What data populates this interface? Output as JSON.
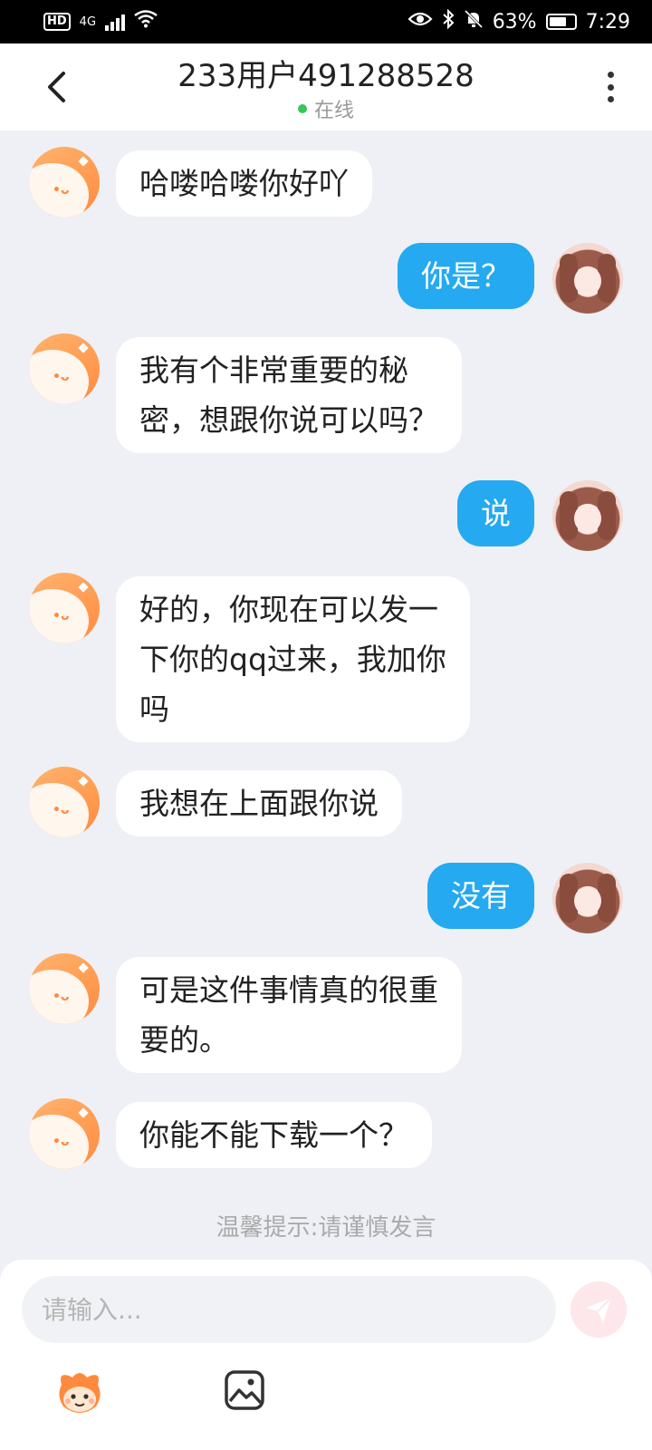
{
  "status_bar": {
    "hd": "HD",
    "network": "4G",
    "battery": "63%",
    "time": "7:29"
  },
  "header": {
    "title": "233用户491288528",
    "presence": "在线"
  },
  "messages": [
    {
      "from": "bot",
      "text": "哈喽哈喽你好吖"
    },
    {
      "from": "user",
      "text": "你是？"
    },
    {
      "from": "bot",
      "text": "我有个非常重要的秘\n密，想跟你说可以吗？"
    },
    {
      "from": "user",
      "text": "说"
    },
    {
      "from": "bot",
      "text": "好的，你现在可以发一\n下你的qq过来，我加你\n吗"
    },
    {
      "from": "bot",
      "text": "我想在上面跟你说"
    },
    {
      "from": "user",
      "text": "没有"
    },
    {
      "from": "bot",
      "text": "可是这件事情真的很重\n要的。"
    },
    {
      "from": "bot",
      "text": "你能不能下载一个？"
    }
  ],
  "tip": "温馨提示:请谨慎发言",
  "composer": {
    "placeholder": "请输入...",
    "value": ""
  },
  "colors": {
    "user_bubble": "#25a9f0",
    "bot_bubble": "#ffffff",
    "presence_dot": "#35c75a",
    "background": "#eef0f5"
  }
}
